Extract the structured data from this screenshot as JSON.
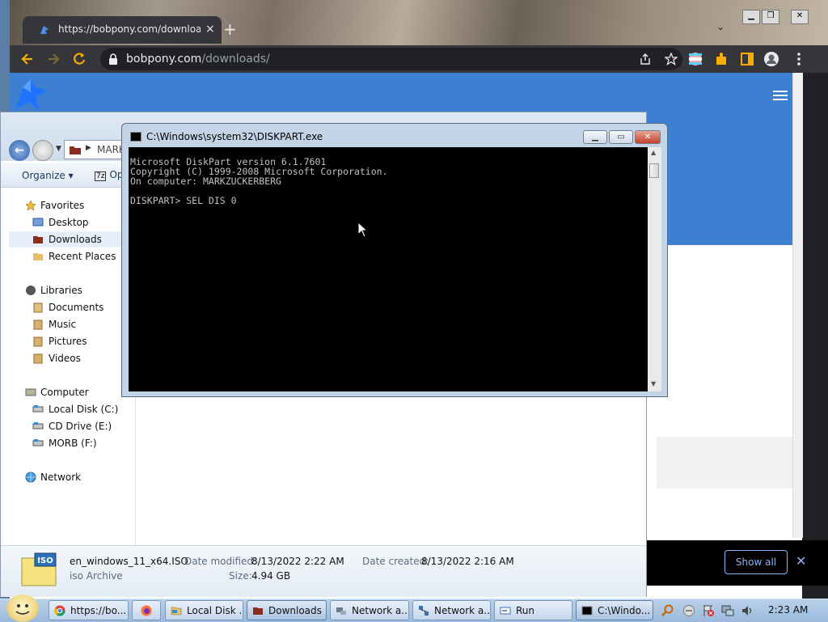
{
  "chrome": {
    "tab_title": "https://bobpony.com/downloads/",
    "new_tab": "+",
    "url_host": "bobpony.com",
    "url_path": "/downloads/",
    "show_all": "Show all",
    "banner_close": "✕"
  },
  "explorer": {
    "address_crumb": "MARK",
    "organize": "Organize",
    "open_with": "Op",
    "nav": {
      "favorites": "Favorites",
      "desktop": "Desktop",
      "downloads": "Downloads",
      "recent_places": "Recent Places",
      "libraries": "Libraries",
      "documents": "Documents",
      "music": "Music",
      "pictures": "Pictures",
      "videos": "Videos",
      "computer": "Computer",
      "local_disk": "Local Disk (C:)",
      "cd_drive": "CD Drive (E:)",
      "morb": "MORB (F:)",
      "network": "Network"
    },
    "details": {
      "icon_label": "ISO",
      "filename": "en_windows_11_x64.ISO",
      "filetype": "iso Archive",
      "date_modified_label": "Date modified:",
      "date_modified": "8/13/2022 2:22 AM",
      "date_created_label": "Date created:",
      "date_created": "8/13/2022 2:16 AM",
      "size_label": "Size:",
      "size": "4.94 GB"
    }
  },
  "console": {
    "title": "C:\\Windows\\system32\\DISKPART.exe",
    "output": "Microsoft DiskPart version 6.1.7601\nCopyright (C) 1999-2008 Microsoft Corporation.\nOn computer: MARKZUCKERBERG\n\nDISKPART> SEL DIS 0"
  },
  "taskbar": {
    "tasks": [
      {
        "label": "https://bo..."
      },
      {
        "label": ""
      },
      {
        "label": "Local Disk ..."
      },
      {
        "label": "Downloads"
      },
      {
        "label": "Network a..."
      },
      {
        "label": "Network a..."
      },
      {
        "label": "Run"
      },
      {
        "label": "C:\\Windo..."
      }
    ],
    "clock": "2:23 AM"
  },
  "colors": {
    "chrome_dark": "#202124",
    "site_blue": "#3d7fd0",
    "console_bg": "#000000",
    "console_text": "#c0c0c0",
    "taskbar": "#b9d1ea"
  }
}
